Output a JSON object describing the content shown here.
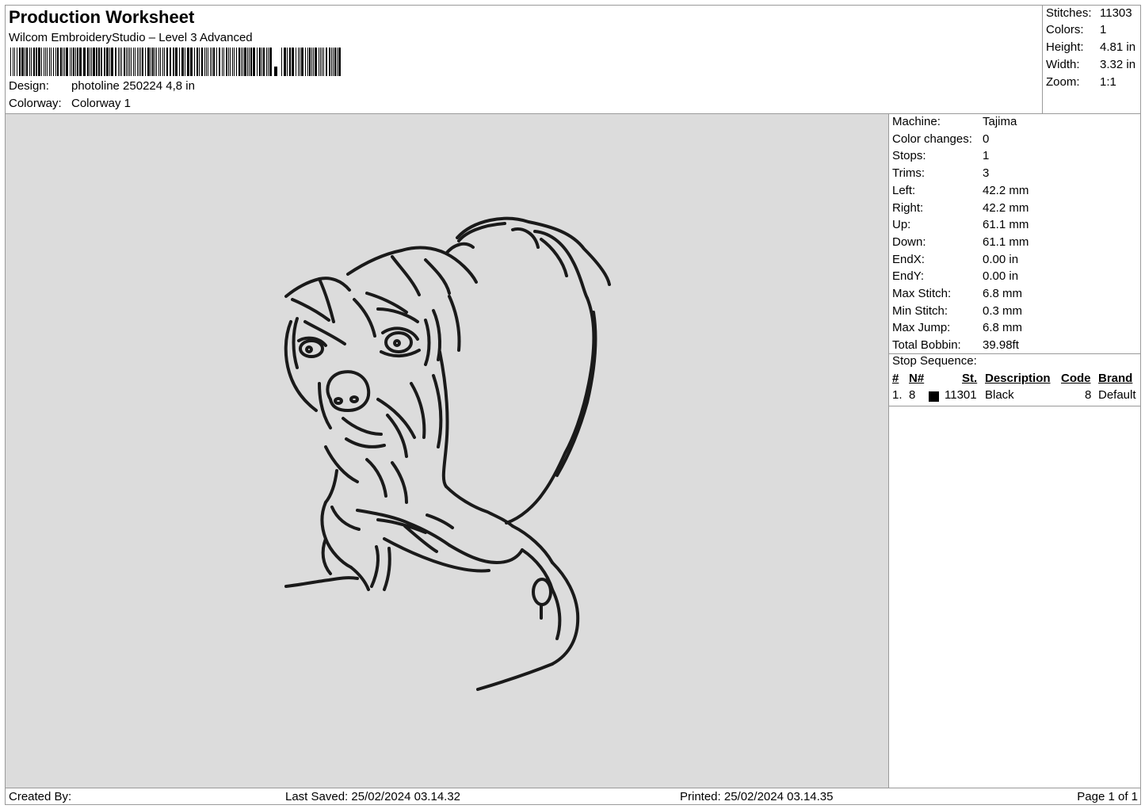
{
  "header": {
    "title": "Production Worksheet",
    "subtitle": "Wilcom EmbroideryStudio – Level 3 Advanced",
    "design_label": "Design:",
    "design_value": "photoline 250224 4,8 in",
    "colorway_label": "Colorway:",
    "colorway_value": "Colorway 1"
  },
  "summary": {
    "stitches_label": "Stitches:",
    "stitches_value": "11303",
    "colors_label": "Colors:",
    "colors_value": "1",
    "height_label": "Height:",
    "height_value": "4.81 in",
    "width_label": "Width:",
    "width_value": "3.32 in",
    "zoom_label": "Zoom:",
    "zoom_value": "1:1"
  },
  "properties": [
    {
      "label": "Machine:",
      "value": "Tajima"
    },
    {
      "label": "Color changes:",
      "value": "0"
    },
    {
      "label": "Stops:",
      "value": "1"
    },
    {
      "label": "Trims:",
      "value": "3"
    },
    {
      "label": "Left:",
      "value": "42.2 mm"
    },
    {
      "label": "Right:",
      "value": "42.2 mm"
    },
    {
      "label": "Up:",
      "value": "61.1 mm"
    },
    {
      "label": "Down:",
      "value": "61.1 mm"
    },
    {
      "label": "EndX:",
      "value": "0.00 in"
    },
    {
      "label": "EndY:",
      "value": "0.00 in"
    },
    {
      "label": "Max Stitch:",
      "value": "6.8 mm"
    },
    {
      "label": "Min Stitch:",
      "value": "0.3 mm"
    },
    {
      "label": "Max Jump:",
      "value": "6.8 mm"
    },
    {
      "label": "Total Bobbin:",
      "value": "39.98ft"
    }
  ],
  "stop_sequence": {
    "title": "Stop Sequence:",
    "headers": {
      "num": "#",
      "n": "N#",
      "st": "St.",
      "description": "Description",
      "code": "Code",
      "brand": "Brand"
    },
    "rows": [
      {
        "num": "1.",
        "n": "8",
        "swatch_color": "#000000",
        "st": "11301",
        "description": "Black",
        "code": "8",
        "brand": "Default"
      }
    ]
  },
  "footer": {
    "created_by": "Created By:",
    "last_saved": "Last Saved: 25/02/2024 03.14.32",
    "printed": "Printed: 25/02/2024 03.14.35",
    "page": "Page 1 of 1"
  },
  "design_preview": {
    "background_color": "#dcdcdc",
    "thread_color": "#1a1a1a"
  }
}
